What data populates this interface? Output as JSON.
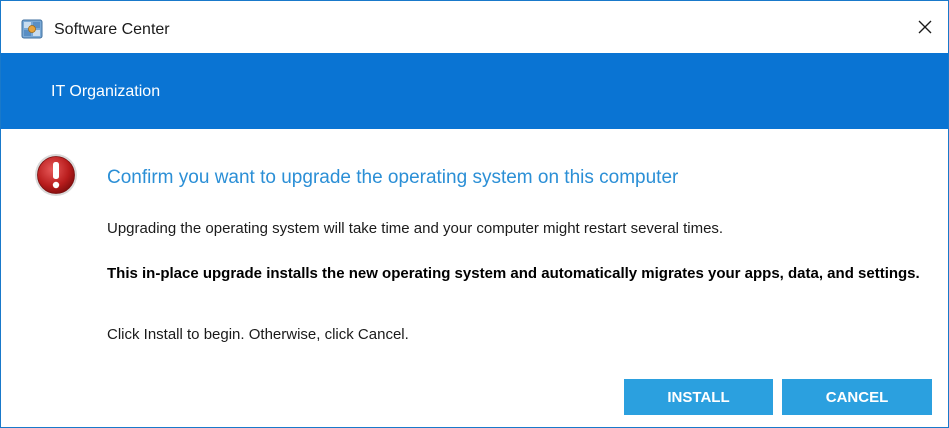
{
  "window": {
    "title": "Software Center",
    "app_icon": "software-center-icon",
    "close_icon": "close-icon"
  },
  "banner": {
    "org_name": "IT Organization",
    "color": "#0a74d3"
  },
  "dialog": {
    "icon": "error-exclamation-icon",
    "heading": "Confirm you want to upgrade the operating system on this computer",
    "paragraph1": "Upgrading the operating system will take time and your computer might restart several times.",
    "paragraph2": "This in-place upgrade installs the new operating system and automatically migrates your apps, data, and settings.",
    "paragraph3": "Click Install to begin. Otherwise, click Cancel.",
    "heading_color": "#2b8fd6"
  },
  "buttons": {
    "install_label": "INSTALL",
    "cancel_label": "CANCEL",
    "color": "#2ba0df"
  }
}
